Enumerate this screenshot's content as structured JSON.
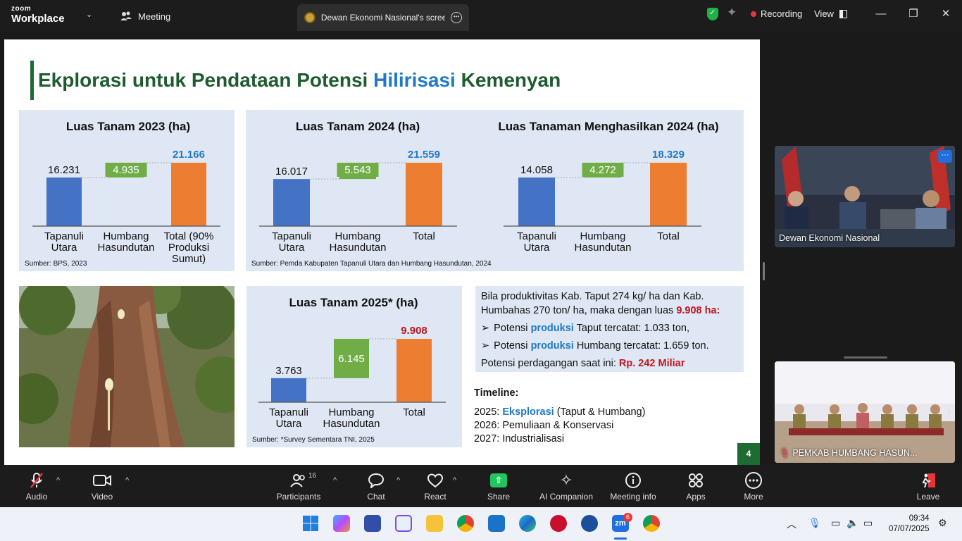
{
  "app": {
    "logo_top": "zoom",
    "logo_bottom": "Workplace",
    "meeting_tab": "Meeting",
    "share_tab": "Dewan Ekonomi Nasional's screen",
    "recording": "Recording",
    "view": "View"
  },
  "slide": {
    "title_part1": "Ekplorasi untuk Pendataan Potensi ",
    "title_highlight": "Hilirisasi",
    "title_part2": " Kemenyan",
    "page_number": "4",
    "source_2023": "Sumber: BPS, 2023",
    "source_2024": "Sumber: Pemda Kabupaten Tapanuli Utara dan Humbang Hasundutan, 2024",
    "source_2025": "Sumber: *Survey Sementara TNI, 2025",
    "info": {
      "line1": "Bila produktivitas Kab. Taput 274 kg/ ha dan Kab.",
      "line2a": "Humbahas 270 ton/ ha, maka dengan luas ",
      "line2b": "9.908 ha:",
      "bullet1a": "Potensi ",
      "bullet1b": "produksi",
      "bullet1c": " Taput tercatat: 1.033 ton,",
      "bullet2a": "Potensi ",
      "bullet2b": "produksi",
      "bullet2c": " Humbang tercatat: 1.659 ton.",
      "trade_a": "Potensi perdagangan saat ini: ",
      "trade_b": "Rp. 242 Miliar"
    },
    "timeline": {
      "heading": "Timeline:",
      "l1a": "2025: ",
      "l1b": "Eksplorasi",
      "l1c": " (Taput & Humbang)",
      "l2": "2026: Pemuliaan & Konservasi",
      "l3": "2027: Industrialisasi"
    }
  },
  "chart_data": [
    {
      "type": "bar",
      "title": "Luas Tanam 2023 (ha)",
      "categories": [
        "Tapanuli Utara",
        "Humbang Hasundutan",
        "Total (90% Produksi Sumut)"
      ],
      "category_lines": [
        [
          "Tapanuli",
          "Utara"
        ],
        [
          "Humbang",
          "Hasundutan"
        ],
        [
          "Total (90%",
          "Produksi",
          "Sumut)"
        ]
      ],
      "values": [
        16231,
        4935,
        21166
      ],
      "labels": [
        "16.231",
        "4.935",
        "21.166"
      ],
      "colors": [
        "#4472c4",
        "#70ad47",
        "#ed7d31"
      ]
    },
    {
      "type": "bar",
      "title": "Luas Tanam 2024 (ha)",
      "categories": [
        "Tapanuli Utara",
        "Humbang Hasundutan",
        "Total"
      ],
      "category_lines": [
        [
          "Tapanuli",
          "Utara"
        ],
        [
          "Humbang",
          "Hasundutan"
        ],
        [
          "Total"
        ]
      ],
      "values": [
        16017,
        5543,
        21559
      ],
      "labels": [
        "16.017",
        "5.543",
        "21.559"
      ],
      "colors": [
        "#4472c4",
        "#70ad47",
        "#ed7d31"
      ]
    },
    {
      "type": "bar",
      "title": "Luas Tanaman Menghasilkan 2024 (ha)",
      "categories": [
        "Tapanuli Utara",
        "Humbang Hasundutan",
        "Total"
      ],
      "category_lines": [
        [
          "Tapanuli",
          "Utara"
        ],
        [
          "Humbang",
          "Hasundutan"
        ],
        [
          "Total"
        ]
      ],
      "values": [
        14058,
        4272,
        18329
      ],
      "labels": [
        "14.058",
        "4.272",
        "18.329"
      ],
      "colors": [
        "#4472c4",
        "#70ad47",
        "#ed7d31"
      ]
    },
    {
      "type": "bar",
      "title": "Luas Tanam 2025* (ha)",
      "categories": [
        "Tapanuli Utara",
        "Humbang Hasundutan",
        "Total"
      ],
      "category_lines": [
        [
          "Tapanuli",
          "Utara"
        ],
        [
          "Humbang",
          "Hasundutan"
        ],
        [
          "Total"
        ]
      ],
      "values": [
        3763,
        6145,
        9908
      ],
      "labels": [
        "3.763",
        "6.145",
        "9.908"
      ],
      "colors": [
        "#4472c4",
        "#70ad47",
        "#ed7d31"
      ]
    }
  ],
  "participants_panel": {
    "tile1_name": "Dewan Ekonomi Nasional",
    "tile2_name": "PEMKAB HUMBANG HASUN..."
  },
  "toolbar": {
    "audio": "Audio",
    "video": "Video",
    "participants": "Participants",
    "participants_count": "16",
    "chat": "Chat",
    "react": "React",
    "share": "Share",
    "ai_companion": "AI Companion",
    "meeting_info": "Meeting info",
    "apps": "Apps",
    "more": "More",
    "leave": "Leave"
  },
  "taskbar": {
    "time": "09:34",
    "date": "07/07/2025",
    "zoom_badge": "6"
  },
  "colors": {
    "accent_green": "#1e6b33",
    "highlight_blue": "#1f78c8",
    "highlight_red": "#c0161d",
    "panel_bg": "#dfe7f4"
  }
}
